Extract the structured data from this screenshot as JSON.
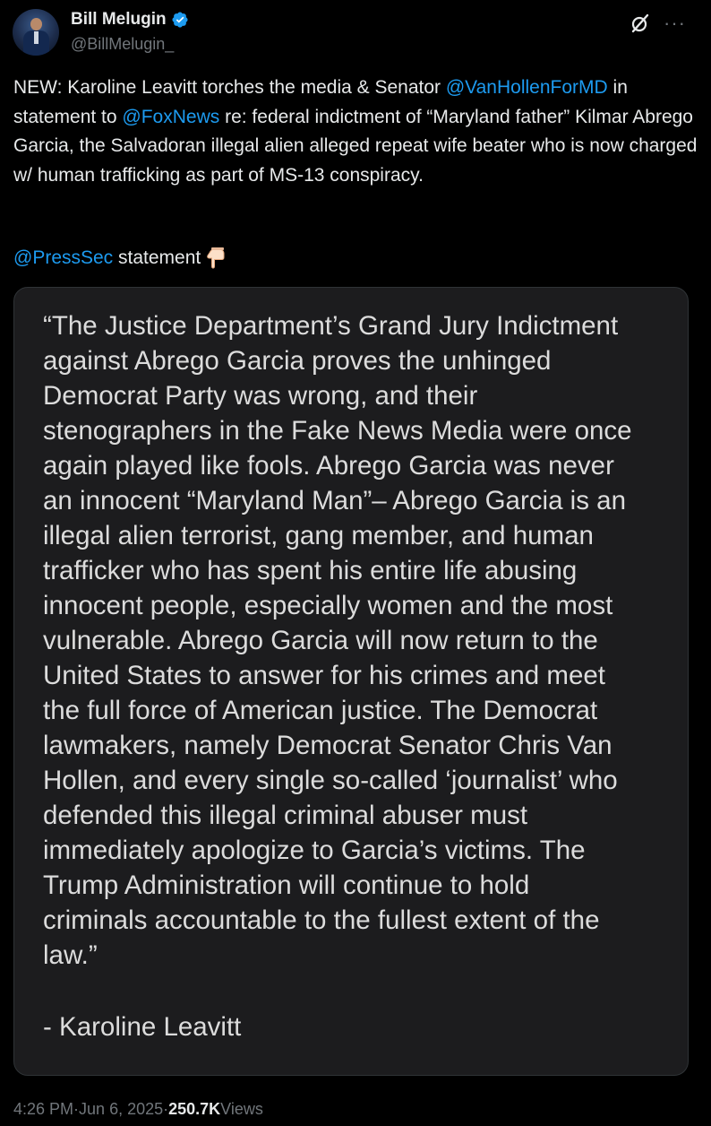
{
  "author": {
    "display_name": "Bill Melugin",
    "handle": "@BillMelugin_",
    "verified": true
  },
  "post": {
    "text_parts": {
      "p1": "NEW: Karoline Leavitt torches the media & Senator ",
      "m1": "@VanHollenForMD",
      "p2": " in statement to ",
      "m2": "@FoxNews",
      "p3": " re: federal indictment of “Maryland father” Kilmar Abrego Garcia, the Salvadoran illegal alien alleged repeat wife beater who is now charged w/ human trafficking as part of MS-13 conspiracy."
    },
    "line2": {
      "mention": "@PressSec",
      "text": " statement",
      "emoji_icon": "backhand-index-pointing-down"
    }
  },
  "media": {
    "statement_lines": [
      "“The Justice Department’s Grand Jury Indictment",
      "against Abrego Garcia proves the unhinged",
      "Democrat Party was wrong, and their",
      "stenographers in the Fake News Media were once",
      "again played like fools. Abrego Garcia was never",
      "an innocent “Maryland Man”– Abrego Garcia is an",
      "illegal alien terrorist, gang member, and human",
      "trafficker who has spent his entire life abusing",
      "innocent people, especially women and the most",
      "vulnerable. Abrego Garcia will now return to the",
      "United States to answer for his crimes and meet",
      "the full force of American justice. The Democrat",
      "lawmakers, namely Democrat Senator Chris Van",
      "Hollen, and every single so-called ‘journalist’ who",
      "defended this illegal criminal abuser must",
      "immediately apologize to Garcia’s victims. The",
      "Trump Administration will continue to hold",
      "criminals accountable to the fullest extent of the",
      "law.”"
    ],
    "signature": "- Karoline Leavitt"
  },
  "footer": {
    "time": "4:26 PM",
    "sep1": " · ",
    "date": "Jun 6, 2025",
    "sep2": " · ",
    "views_count": "250.7K",
    "views_label": " Views"
  },
  "icons": {
    "verified": "verified-badge-icon",
    "grok": "grok-icon",
    "more": "more-icon"
  },
  "colors": {
    "background": "#000000",
    "text": "#e7e9ea",
    "secondary": "#71767b",
    "link": "#1d9bf0",
    "card": "#1c1c1e"
  }
}
